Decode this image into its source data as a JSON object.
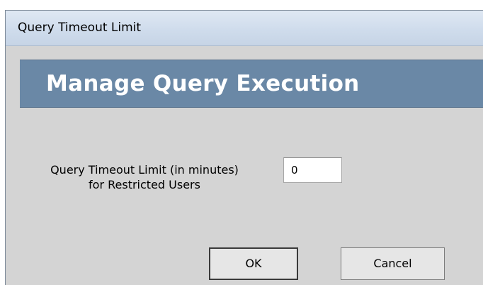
{
  "window": {
    "title": "Query Timeout Limit"
  },
  "banner": {
    "heading": "Manage Query Execution"
  },
  "form": {
    "label_line1": "Query Timeout Limit (in minutes)",
    "label_line2": "for Restricted Users",
    "timeout_value": "0"
  },
  "buttons": {
    "ok_label": "OK",
    "cancel_label": "Cancel"
  },
  "colors": {
    "banner_background": "#6a88a6",
    "dialog_background": "#d4d4d4",
    "banner_text": "#ffffff"
  }
}
